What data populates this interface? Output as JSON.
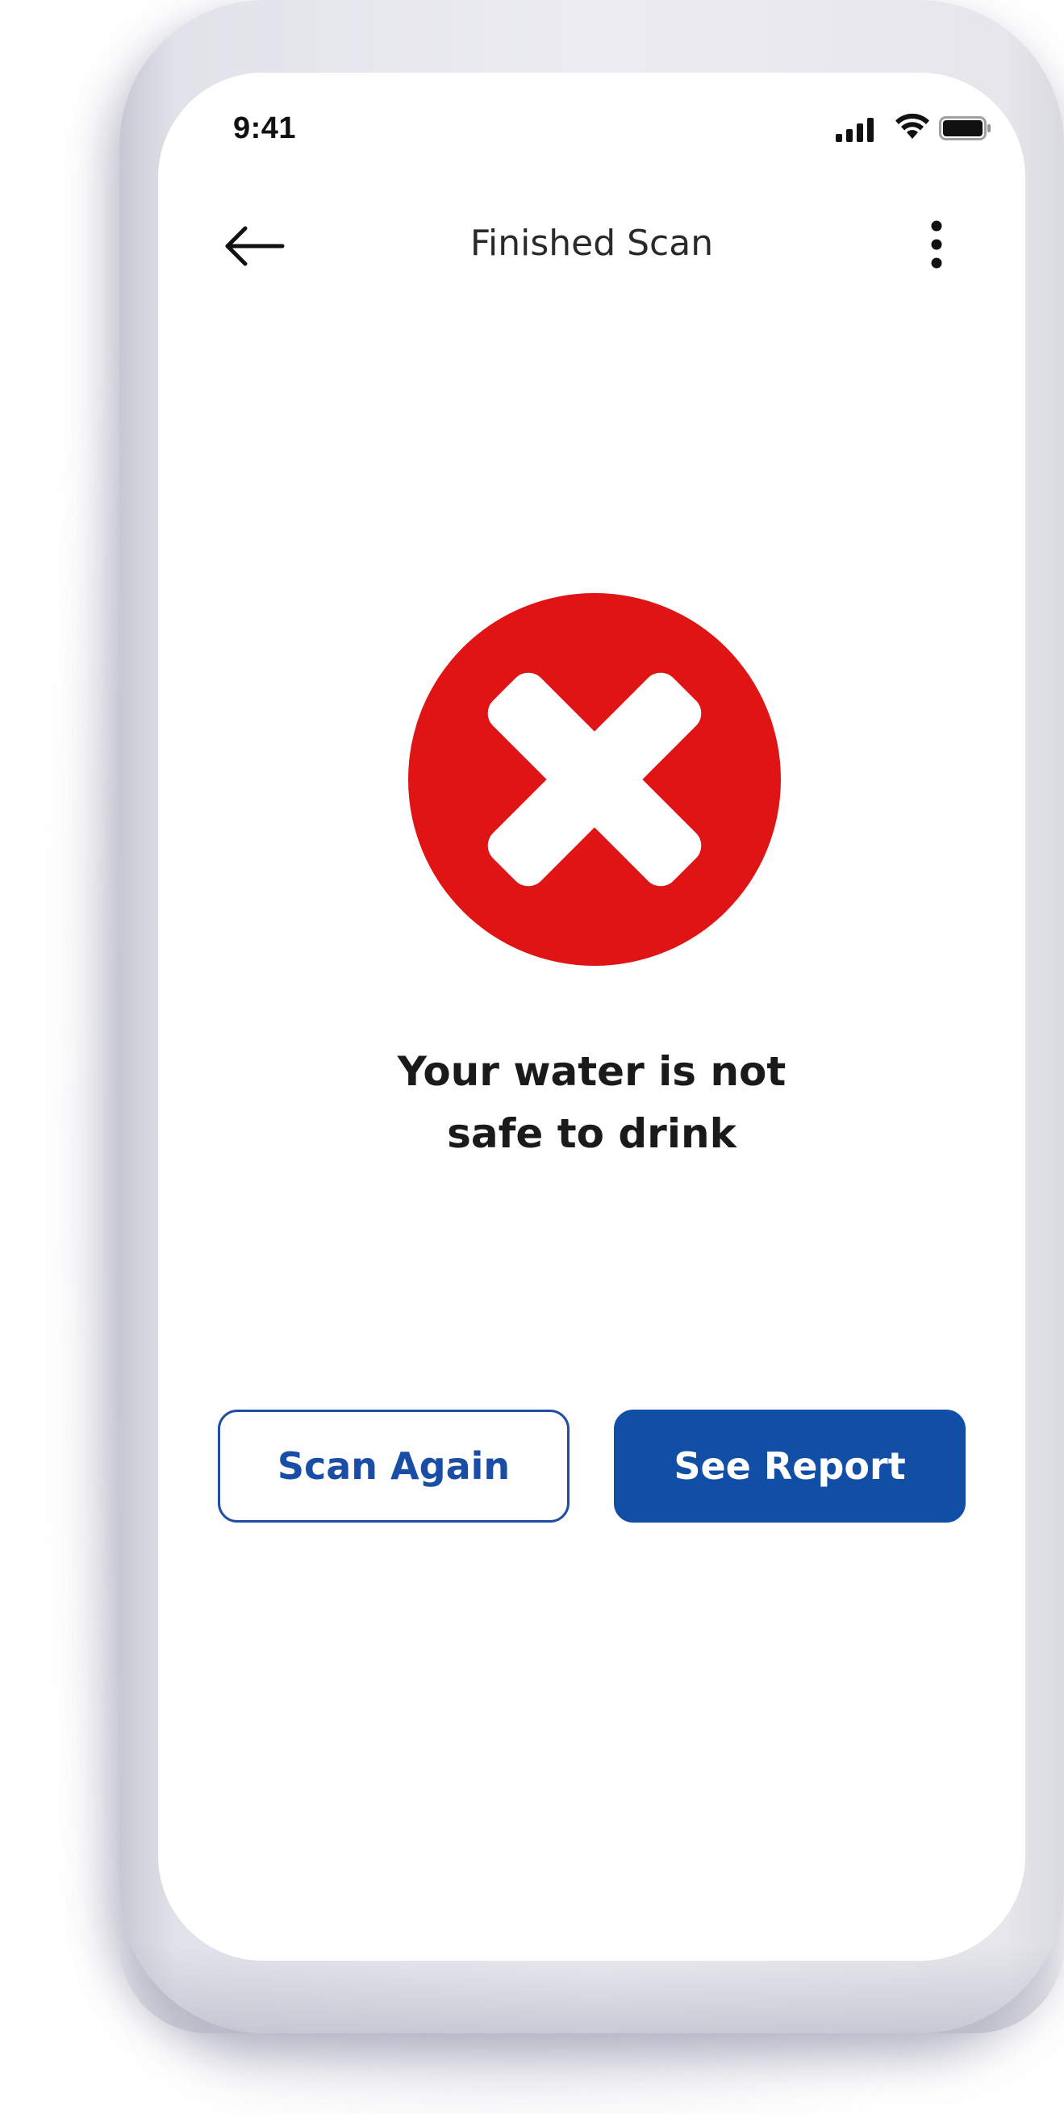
{
  "status_bar": {
    "time": "9:41",
    "icons": [
      "signal-icon",
      "wifi-icon",
      "battery-icon"
    ]
  },
  "header": {
    "back_icon": "arrow-left-icon",
    "title": "Finished Scan",
    "more_icon": "more-vertical-icon"
  },
  "result": {
    "icon": "error-x-circle-icon",
    "icon_color": "#e01414",
    "message_line1": "Your water is not",
    "message_line2": "safe to drink"
  },
  "actions": {
    "scan_again_label": "Scan Again",
    "see_report_label": "See Report",
    "primary_color": "#114fa6"
  }
}
